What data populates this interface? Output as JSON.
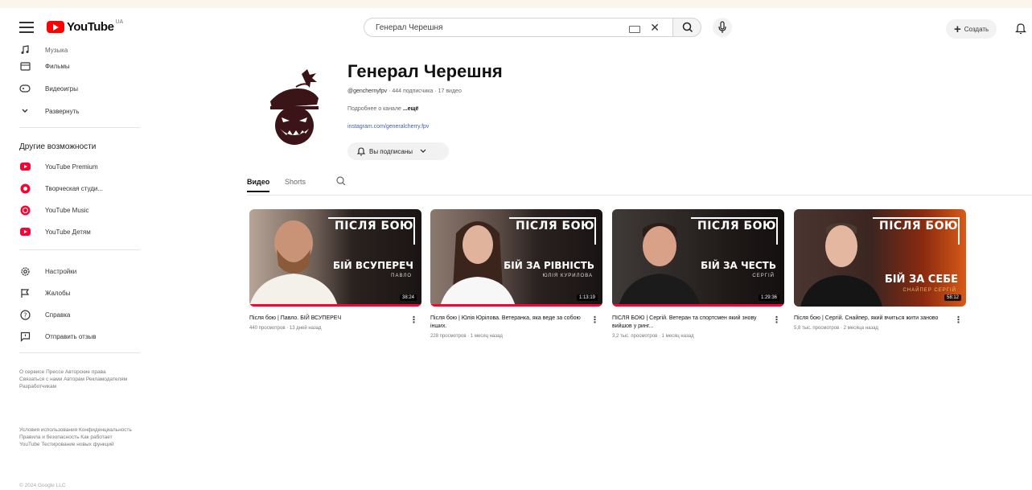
{
  "header": {
    "logo_text": "YouTube",
    "logo_region": "UA",
    "search_value": "Генерал Черешня",
    "create_label": "Создать"
  },
  "sidebar": {
    "items_top": [
      {
        "label": "Музыка",
        "icon": "music-icon"
      },
      {
        "label": "Фильмы",
        "icon": "film-icon"
      },
      {
        "label": "Видеоигры",
        "icon": "gamepad-icon"
      },
      {
        "label": "Развернуть",
        "icon": "chevron-down-icon"
      }
    ],
    "section_title": "Другие возможности",
    "more_items": [
      {
        "label": "YouTube Premium"
      },
      {
        "label": "Творческая студи..."
      },
      {
        "label": "YouTube Music"
      },
      {
        "label": "YouTube Детям"
      }
    ],
    "settings_items": [
      {
        "label": "Настройки",
        "icon": "gear-icon"
      },
      {
        "label": "Жалобы",
        "icon": "flag-icon"
      },
      {
        "label": "Справка",
        "icon": "help-icon"
      },
      {
        "label": "Отправить отзыв",
        "icon": "feedback-icon"
      }
    ],
    "footer1": "О сервисе Прессе Авторские права Связаться с нами Авторам Рекламодателям Разработчикам",
    "footer2": "Условия использования Конфиденциальность Правила и безопасность Как работает YouTube Тестирование новых функций",
    "copyright": "© 2024 Google LLC"
  },
  "channel": {
    "name": "Генерал Черешня",
    "handle": "@genchernyfpv",
    "stats": " · 444 подписчика · 17 видео",
    "desc": "Подробнее о канале",
    "desc_more": " ...ещё",
    "link": "instagram.com/generalcherry.fpv",
    "subscribe_label": "Вы подписаны"
  },
  "tabs": {
    "videos": "Видео",
    "shorts": "Shorts"
  },
  "videos": [
    {
      "title": "Після бою | Павло. БІЙ ВСУПЕРЕЧ",
      "meta": "440 просмотров · 13 дней назад",
      "duration": "38:24",
      "headline": "БІЙ ВСУПЕРЕЧ",
      "subname": "ПАВЛО",
      "brand": "ПІСЛЯ БОЮ",
      "progress": 1.0
    },
    {
      "title": "Після бою | Юлія Юрілова. Ветеранка, яка веде за собою інших.",
      "meta": "228 просмотров · 1 месяц назад",
      "duration": "1:13:19",
      "headline": "БІЙ ЗА РІВНІСТЬ",
      "subname": "ЮЛІЯ КУРИЛОВА",
      "brand": "ПІСЛЯ БОЮ",
      "progress": 1.0
    },
    {
      "title": "ПІСЛЯ БОЮ | Сергій. Ветеран та спортсмен який знову вийшов у ринг...",
      "meta": "3,2 тыс. просмотров · 1 месяц назад",
      "duration": "1:29:36",
      "headline": "БІЙ ЗА ЧЕСТЬ",
      "subname": "СЕРГІЙ",
      "brand": "ПІСЛЯ БОЮ",
      "progress": 1.0
    },
    {
      "title": "Після бою | Сергій. Снайпер, який вчиться жити заново",
      "meta": "5,8 тыс. просмотров · 2 месяца назад",
      "duration": "58:12",
      "headline": "БІЙ ЗА СЕБЕ",
      "subname": "СНАЙПЕР СЕРГІЙ",
      "brand": "ПІСЛЯ БОЮ",
      "progress": 0.0
    }
  ],
  "colors": {
    "accent": "#ff0033",
    "avatar": "#3b1418",
    "logo": "#ff0000"
  }
}
